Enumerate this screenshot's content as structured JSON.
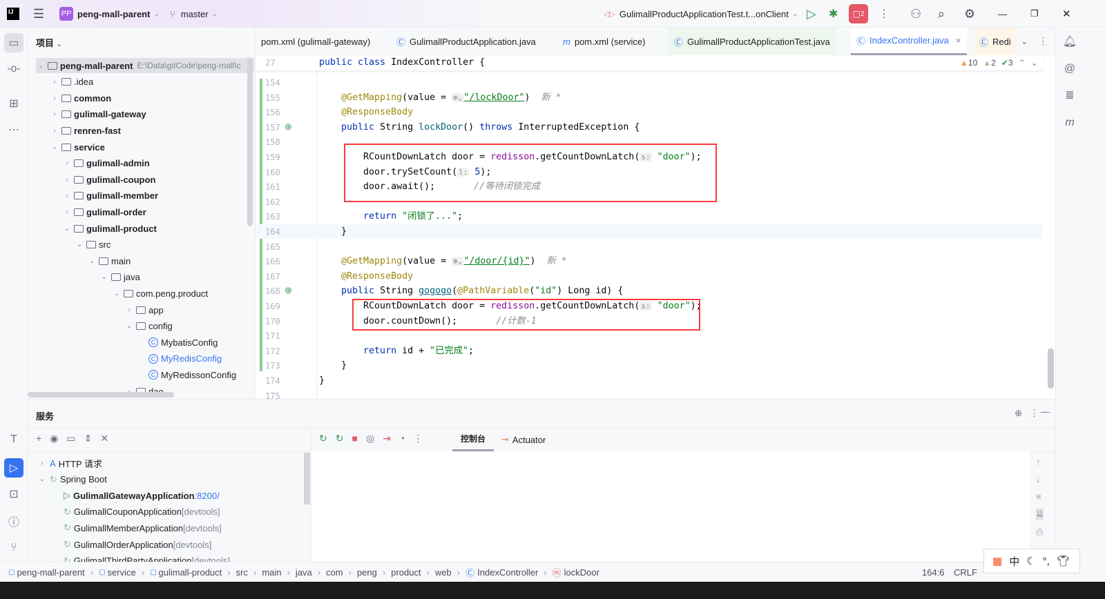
{
  "topbar": {
    "project_badge": "PP",
    "project": "peng-mall-parent",
    "branch": "master",
    "run_config": "GulimallProductApplicationTest.t...onClient",
    "notif_count": "2"
  },
  "project_panel": {
    "title": "项目",
    "tree": [
      {
        "label": "peng-mall-parent",
        "path": "E:\\Data\\gitCode\\peng-mall\\c",
        "depth": 0,
        "open": true,
        "type": "module",
        "bold": true
      },
      {
        "label": ".idea",
        "depth": 1,
        "open": false,
        "type": "folder"
      },
      {
        "label": "common",
        "depth": 1,
        "open": false,
        "type": "module",
        "bold": true
      },
      {
        "label": "gulimall-gateway",
        "depth": 1,
        "open": false,
        "type": "module",
        "bold": true
      },
      {
        "label": "renren-fast",
        "depth": 1,
        "open": false,
        "type": "module",
        "bold": true
      },
      {
        "label": "service",
        "depth": 1,
        "open": true,
        "type": "module",
        "bold": true
      },
      {
        "label": "gulimall-admin",
        "depth": 2,
        "open": false,
        "type": "module",
        "bold": true
      },
      {
        "label": "gulimall-coupon",
        "depth": 2,
        "open": false,
        "type": "module",
        "bold": true
      },
      {
        "label": "gulimall-member",
        "depth": 2,
        "open": false,
        "type": "module",
        "bold": true
      },
      {
        "label": "gulimall-order",
        "depth": 2,
        "open": false,
        "type": "module",
        "bold": true
      },
      {
        "label": "gulimall-product",
        "depth": 2,
        "open": true,
        "type": "module",
        "bold": true
      },
      {
        "label": "src",
        "depth": 3,
        "open": true,
        "type": "folder"
      },
      {
        "label": "main",
        "depth": 4,
        "open": true,
        "type": "folder"
      },
      {
        "label": "java",
        "depth": 5,
        "open": true,
        "type": "folder"
      },
      {
        "label": "com.peng.product",
        "depth": 6,
        "open": true,
        "type": "package"
      },
      {
        "label": "app",
        "depth": 7,
        "open": false,
        "type": "package"
      },
      {
        "label": "config",
        "depth": 7,
        "open": true,
        "type": "package"
      },
      {
        "label": "MybatisConfig",
        "depth": 8,
        "type": "class"
      },
      {
        "label": "MyRedisConfig",
        "depth": 8,
        "type": "class",
        "color": "#3574f0"
      },
      {
        "label": "MyRedissonConfig",
        "depth": 8,
        "type": "class"
      },
      {
        "label": "dao",
        "depth": 7,
        "open": false,
        "type": "package"
      }
    ]
  },
  "tabs": [
    {
      "label": "pom.xml (gulimall-gateway)",
      "icon": "none"
    },
    {
      "label": "GulimallProductApplication.java",
      "icon": "spring-class-icon"
    },
    {
      "label": "pom.xml (service)",
      "icon": "maven-icon"
    },
    {
      "label": "GulimallProductApplicationTest.java",
      "icon": "test-class-icon"
    },
    {
      "label": "IndexController.java",
      "icon": "class-icon",
      "active": true
    },
    {
      "label": "Redi",
      "icon": "class-icon"
    }
  ],
  "inspections": {
    "warnings": "10",
    "weak_warnings": "2",
    "typos": "3"
  },
  "editor": {
    "sticky_line": "27",
    "sticky_code": [
      [
        "kw",
        "public class "
      ],
      [
        "tx",
        "IndexController {"
      ]
    ],
    "lines": [
      {
        "n": "154",
        "t": []
      },
      {
        "n": "155",
        "t": [
          [
            "an",
            "    @GetMapping"
          ],
          [
            "tx",
            "(value = "
          ],
          [
            "ht",
            "⊕⌄"
          ],
          [
            "st ul",
            "\"/lockDoor\""
          ],
          [
            "tx",
            ")  "
          ],
          [
            "cm",
            "新 *"
          ]
        ]
      },
      {
        "n": "156",
        "t": [
          [
            "an",
            "    @ResponseBody"
          ]
        ]
      },
      {
        "n": "157",
        "t": [
          [
            "kw",
            "    public "
          ],
          [
            "tx",
            "String "
          ],
          [
            "fn",
            "lockDoor"
          ],
          [
            "tx",
            "() "
          ],
          [
            "kw",
            "throws "
          ],
          [
            "tx",
            "InterruptedException {"
          ]
        ]
      },
      {
        "n": "158",
        "t": []
      },
      {
        "n": "159",
        "t": [
          [
            "tx",
            "        RCountDownLatch door = "
          ],
          [
            "fld",
            "redisson"
          ],
          [
            "tx",
            ".getCountDownLatch("
          ],
          [
            "ht",
            "s:"
          ],
          [
            "st",
            " \"door\""
          ],
          [
            "tx",
            ");"
          ]
        ]
      },
      {
        "n": "160",
        "t": [
          [
            "tx",
            "        door.trySetCount("
          ],
          [
            "ht",
            "l:"
          ],
          [
            "kw",
            " 5"
          ],
          [
            "tx",
            ");"
          ]
        ]
      },
      {
        "n": "161",
        "t": [
          [
            "tx",
            "        door.await();       "
          ],
          [
            "cm",
            "//等待闭锁完成"
          ]
        ]
      },
      {
        "n": "162",
        "t": []
      },
      {
        "n": "163",
        "t": [
          [
            "kw",
            "        return "
          ],
          [
            "st",
            "\"闭锁了...\""
          ],
          [
            "tx",
            ";"
          ]
        ]
      },
      {
        "n": "164",
        "t": [
          [
            "tx",
            "    }"
          ]
        ]
      },
      {
        "n": "165",
        "t": []
      },
      {
        "n": "166",
        "t": [
          [
            "an",
            "    @GetMapping"
          ],
          [
            "tx",
            "(value = "
          ],
          [
            "ht",
            "⊕⌄"
          ],
          [
            "st ul",
            "\"/door/{id}\""
          ],
          [
            "tx",
            ")  "
          ],
          [
            "cm",
            "新 *"
          ]
        ]
      },
      {
        "n": "167",
        "t": [
          [
            "an",
            "    @ResponseBody"
          ]
        ]
      },
      {
        "n": "168",
        "t": [
          [
            "kw",
            "    public "
          ],
          [
            "tx",
            "String "
          ],
          [
            "fn ul",
            "gogogo"
          ],
          [
            "tx",
            "("
          ],
          [
            "an",
            "@PathVariable"
          ],
          [
            "tx",
            "("
          ],
          [
            "st",
            "\"id\""
          ],
          [
            "tx",
            ") Long id) {"
          ]
        ]
      },
      {
        "n": "169",
        "t": [
          [
            "tx",
            "        RCountDownLatch door = "
          ],
          [
            "fld",
            "redisson"
          ],
          [
            "tx",
            ".getCountDownLatch("
          ],
          [
            "ht",
            "s:"
          ],
          [
            "st",
            " \"door\""
          ],
          [
            "tx",
            ");"
          ]
        ]
      },
      {
        "n": "170",
        "t": [
          [
            "tx",
            "        door.countDown();       "
          ],
          [
            "cm",
            "//计数-1"
          ]
        ]
      },
      {
        "n": "171",
        "t": []
      },
      {
        "n": "172",
        "t": [
          [
            "kw",
            "        return "
          ],
          [
            "tx",
            "id + "
          ],
          [
            "st",
            "\"已完成\""
          ],
          [
            "tx",
            ";"
          ]
        ]
      },
      {
        "n": "173",
        "t": [
          [
            "tx",
            "    }"
          ]
        ]
      },
      {
        "n": "174",
        "t": [
          [
            "tx",
            "}"
          ]
        ]
      },
      {
        "n": "175",
        "t": []
      }
    ]
  },
  "services": {
    "title": "服务",
    "console_tab": "控制台",
    "actuator_tab": "Actuator",
    "tree": [
      {
        "label": "HTTP 请求",
        "depth": 0,
        "chev": "›",
        "suffix": ""
      },
      {
        "label": "Spring Boot",
        "depth": 0,
        "chev": "⌄",
        "suffix": ""
      },
      {
        "label": "GulimallGatewayApplication",
        "depth": 1,
        "suffix": " :8200/",
        "running": true
      },
      {
        "label": "GulimallCouponApplication",
        "depth": 1,
        "suffix": " [devtools]"
      },
      {
        "label": "GulimallMemberApplication",
        "depth": 1,
        "suffix": " [devtools]"
      },
      {
        "label": "GulimallOrderApplication",
        "depth": 1,
        "suffix": " [devtools]"
      },
      {
        "label": "GulimallThirdPartyApplication",
        "depth": 1,
        "suffix": " [devtools]"
      }
    ]
  },
  "statusbar": {
    "crumbs": [
      "peng-mall-parent",
      "service",
      "gulimall-product",
      "src",
      "main",
      "java",
      "com",
      "peng",
      "product",
      "web",
      "IndexController",
      "lockDoor"
    ],
    "position": "164:6",
    "line_sep": "CRLF"
  },
  "ime": {
    "lang": "中"
  },
  "colors": {
    "accent": "#3574f0",
    "highlight_box": "#ff3b3b",
    "run_green": "#369650",
    "notif_red": "#e55765"
  }
}
